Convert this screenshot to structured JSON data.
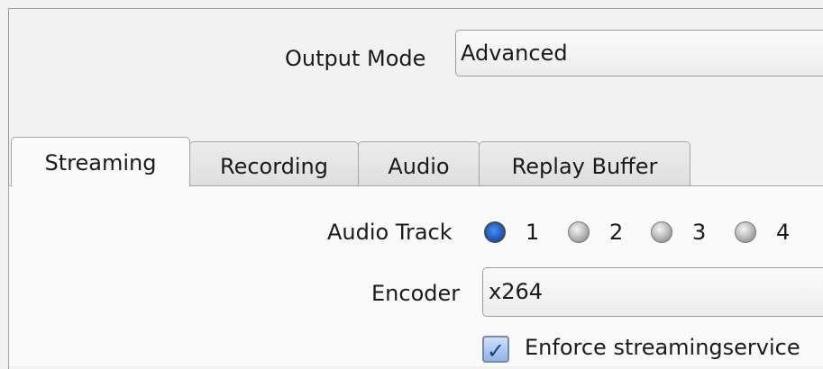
{
  "output": {
    "label": "Output Mode",
    "value": "Advanced"
  },
  "tabs": [
    {
      "label": "Streaming",
      "active": true
    },
    {
      "label": "Recording",
      "active": false
    },
    {
      "label": "Audio",
      "active": false
    },
    {
      "label": "Replay Buffer",
      "active": false
    }
  ],
  "streaming": {
    "audio_track_label": "Audio Track",
    "audio_tracks": [
      "1",
      "2",
      "3",
      "4"
    ],
    "selected_track": "1",
    "encoder_label": "Encoder",
    "encoder_value": "x264",
    "enforce_label": "Enforce streamingservice",
    "enforce_checked": true
  }
}
